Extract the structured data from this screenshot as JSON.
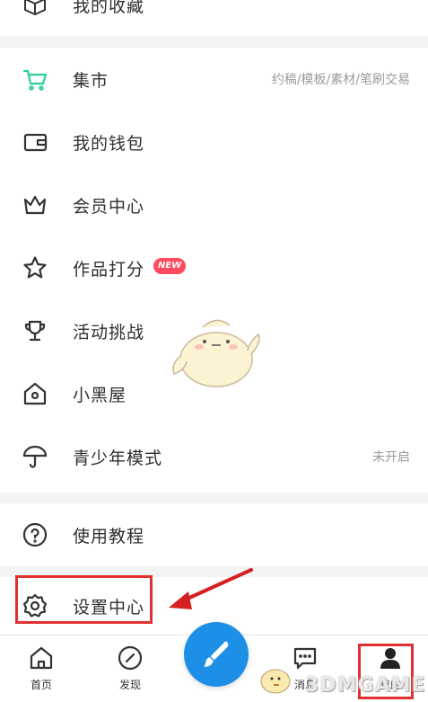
{
  "menu_top": {
    "favorites_label": "我的收藏"
  },
  "menu_main": [
    {
      "label": "集市",
      "icon": "cart-icon",
      "right": "约稿/模板/素材/笔刷交易"
    },
    {
      "label": "我的钱包",
      "icon": "wallet-icon",
      "right": ""
    },
    {
      "label": "会员中心",
      "icon": "crown-icon",
      "right": ""
    },
    {
      "label": "作品打分",
      "icon": "star-icon",
      "right": "",
      "badge": "NEW"
    },
    {
      "label": "活动挑战",
      "icon": "trophy-icon",
      "right": ""
    },
    {
      "label": "小黑屋",
      "icon": "house-icon",
      "right": ""
    },
    {
      "label": "青少年模式",
      "icon": "umbrella-icon",
      "right": "未开启"
    }
  ],
  "menu_help": {
    "label": "使用教程",
    "icon": "question-icon"
  },
  "menu_settings": {
    "label": "设置中心",
    "icon": "gear-icon"
  },
  "tabbar": {
    "home_label": "首页",
    "discover_label": "发现",
    "message_label": "消息",
    "profile_label": "我的"
  },
  "watermark": {
    "text": "3DMGAME"
  },
  "colors": {
    "accent_green": "#2ecf9a",
    "center_blue": "#1e8fe6",
    "annotation_red": "#e03030",
    "badge_red": "#ff4a5f"
  }
}
